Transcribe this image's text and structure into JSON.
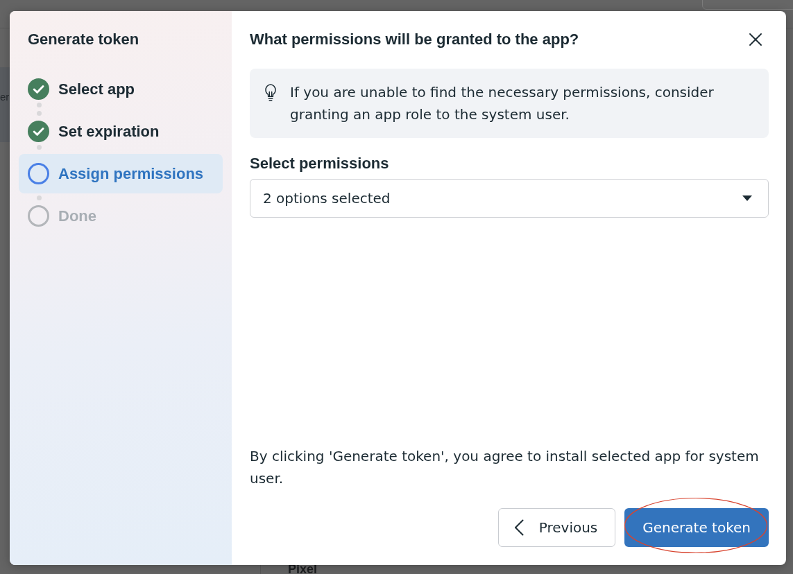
{
  "background": {
    "side_text": "er",
    "section_title": "Pixel"
  },
  "sidebar": {
    "title": "Generate token",
    "steps": [
      {
        "label": "Select app",
        "completed": true,
        "selected": false
      },
      {
        "label": "Set expiration",
        "completed": true,
        "selected": false
      },
      {
        "label": "Assign permissions",
        "completed": false,
        "selected": true
      },
      {
        "label": "Done",
        "completed": false,
        "selected": false
      }
    ]
  },
  "dialog": {
    "title": "What permissions will be granted to the app?",
    "info_notice": "If you are unable to find the necessary permissions, consider granting an app role to the system user.",
    "permissions_field": {
      "label": "Select permissions",
      "value": "2 options selected"
    },
    "consent_text": "By clicking 'Generate token', you agree to install selected app for system user.",
    "buttons": [
      {
        "label": "Previous",
        "kind": "secondary",
        "highlighted": false
      },
      {
        "label": "Generate token",
        "kind": "primary",
        "highlighted": true
      }
    ]
  }
}
